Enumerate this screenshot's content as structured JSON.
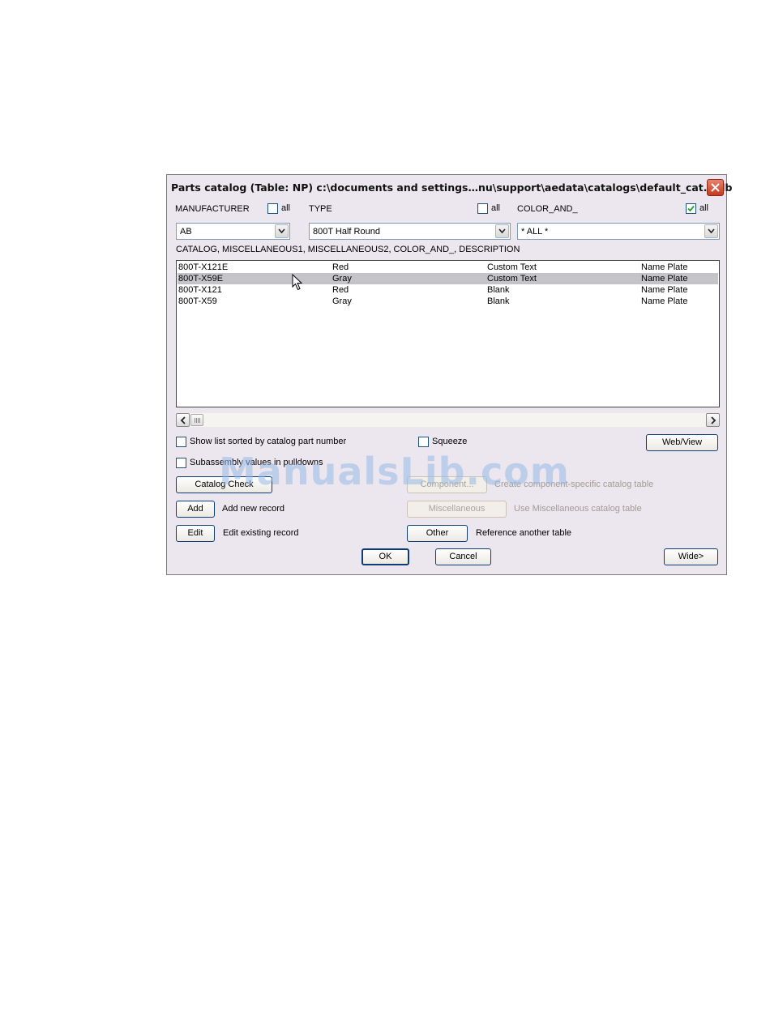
{
  "dialog": {
    "title": "Parts catalog (Table: NP) c:\\documents and settings…nu\\support\\aedata\\catalogs\\default_cat.mdb"
  },
  "filters": {
    "manufacturer": {
      "label": "MANUFACTURER",
      "all_label": "all",
      "all_checked": false,
      "value": "AB"
    },
    "type": {
      "label": "TYPE",
      "all_label": "all",
      "all_checked": false,
      "value": "800T Half Round"
    },
    "color": {
      "label": "COLOR_AND_",
      "all_label": "all",
      "all_checked": true,
      "value": "* ALL *"
    }
  },
  "list": {
    "columns_header": "CATALOG, MISCELLANEOUS1, MISCELLANEOUS2, COLOR_AND_, DESCRIPTION",
    "rows": [
      {
        "c1": "800T-X121E",
        "c2": "Red",
        "c3": "Custom Text",
        "c4": "Name Plate",
        "selected": false
      },
      {
        "c1": "800T-X59E",
        "c2": "Gray",
        "c3": "Custom Text",
        "c4": "Name Plate",
        "selected": true
      },
      {
        "c1": "800T-X121",
        "c2": "Red",
        "c3": "Blank",
        "c4": "Name Plate",
        "selected": false
      },
      {
        "c1": "800T-X59",
        "c2": "Gray",
        "c3": "Blank",
        "c4": "Name Plate",
        "selected": false
      }
    ]
  },
  "options": {
    "sorted_label": "Show list sorted by catalog part number",
    "squeeze_label": "Squeeze",
    "subassembly_label": "Subassembly values in pulldowns",
    "web_view_label": "Web/View"
  },
  "actions": {
    "catalog_check": "Catalog Check",
    "component": "Component...",
    "component_desc": "Create component-specific catalog table",
    "add": "Add",
    "add_desc": "Add new record",
    "miscellaneous": "Miscellaneous",
    "misc_desc": "Use Miscellaneous catalog table",
    "edit": "Edit",
    "edit_desc": "Edit existing record",
    "other": "Other",
    "other_desc": "Reference another table"
  },
  "footer": {
    "ok": "OK",
    "cancel": "Cancel",
    "wide": "Wide>"
  },
  "watermark": "ManualsLib.com",
  "colors": {
    "dialog_bg": "#ece6ee",
    "selection": "#c4c4c8",
    "close_red": "#c9391f"
  }
}
